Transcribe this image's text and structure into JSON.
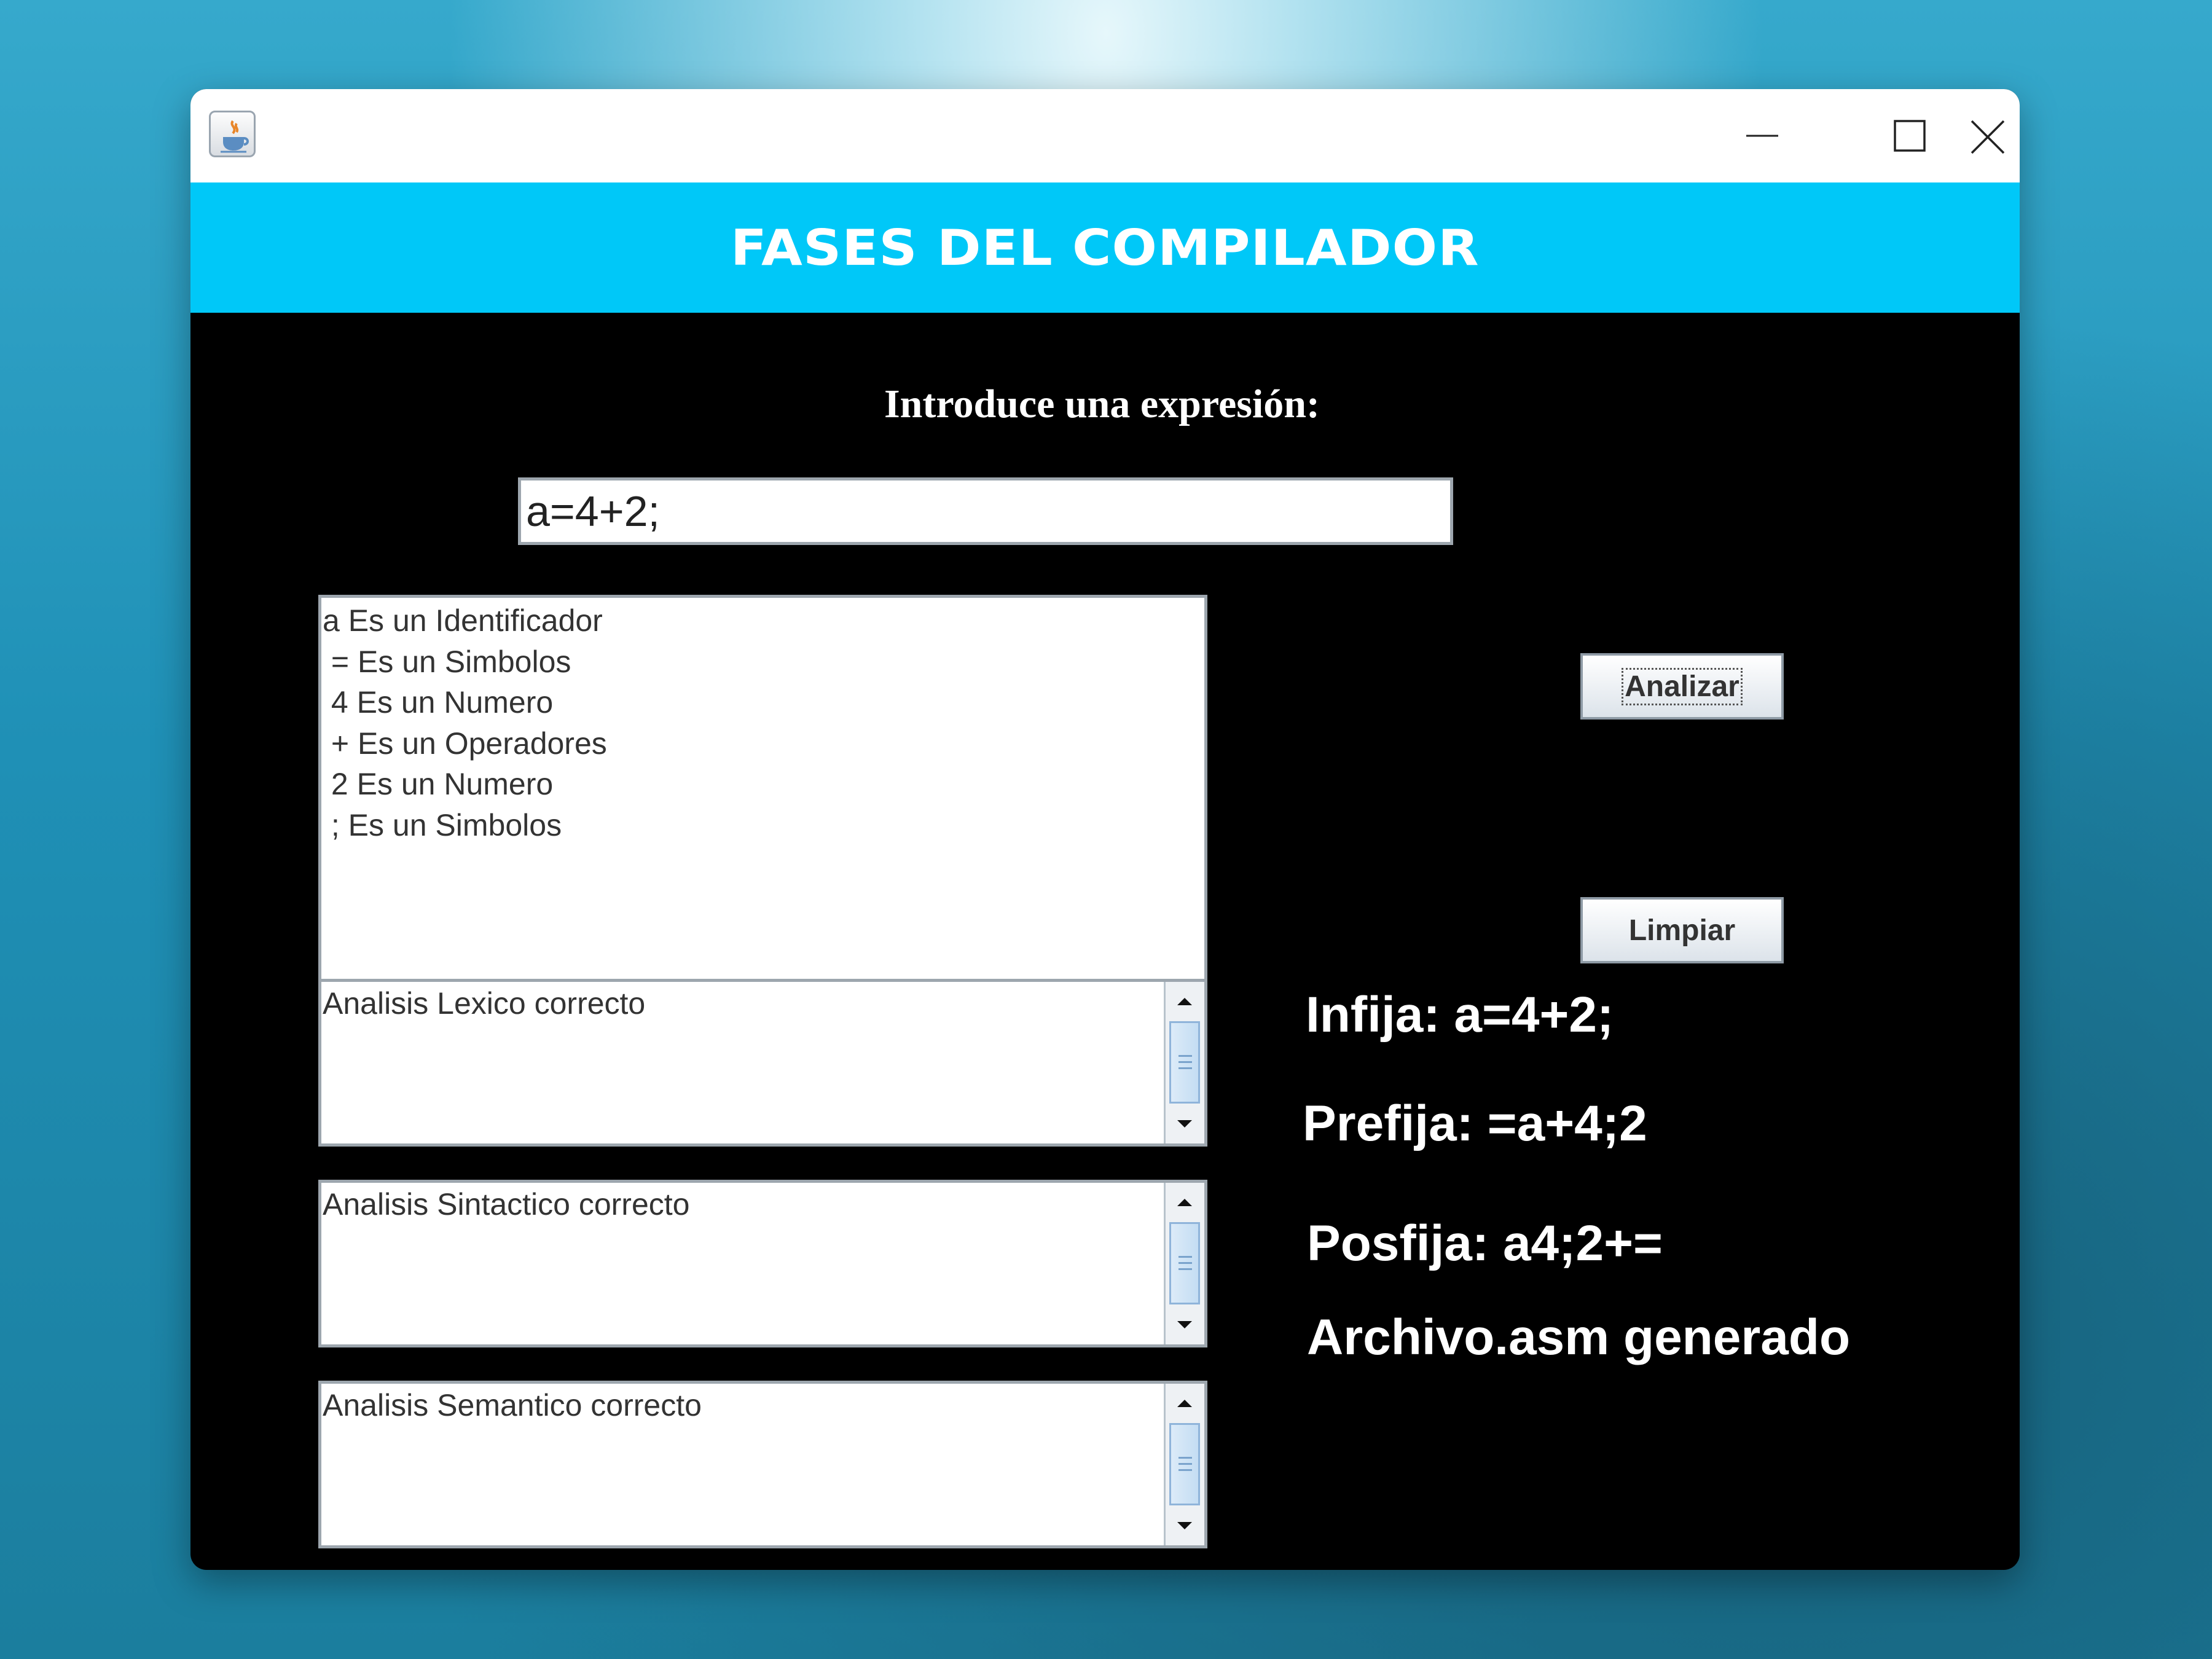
{
  "header": {
    "title": "FASES DEL COMPILADOR"
  },
  "prompt": {
    "label": "Introduce una expresión:"
  },
  "input": {
    "value": "a=4+2;"
  },
  "tokens": [
    "a Es un Identificador",
    " = Es un Simbolos",
    " 4 Es un Numero",
    " + Es un Operadores",
    " 2 Es un Numero",
    " ; Es un Simbolos"
  ],
  "results": {
    "lexico": "Analisis Lexico correcto",
    "sintactico": "Analisis Sintactico correcto",
    "semantico": "Analisis Semantico correcto"
  },
  "buttons": {
    "analizar": "Analizar",
    "limpiar": "Limpiar"
  },
  "notation": {
    "infija": "Infija: a=4+2;",
    "prefija": "Prefija: =a+4;2",
    "posfija": "Posfija: a4;2+=",
    "archivo": "Archivo.asm generado"
  },
  "colors": {
    "header_bg": "#00c8f8",
    "panel_bg": "#000000",
    "text_light": "#ffffff"
  },
  "icons": [
    "java-app-icon",
    "minimize-icon",
    "maximize-icon",
    "close-icon",
    "scroll-up-icon",
    "scroll-down-icon"
  ]
}
